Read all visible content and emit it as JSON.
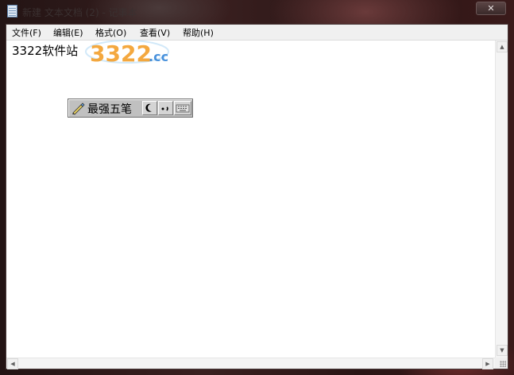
{
  "window": {
    "title": "新建 文本文档 (2) - 记事本",
    "close_label": "✕"
  },
  "menu": {
    "items": [
      {
        "label": "文件(F)"
      },
      {
        "label": "编辑(E)"
      },
      {
        "label": "格式(O)"
      },
      {
        "label": "查看(V)"
      },
      {
        "label": "帮助(H)"
      }
    ]
  },
  "editor": {
    "content": "3322软件站"
  },
  "watermark": {
    "text": "3322.cc",
    "colors": {
      "orange": "#f39a1e",
      "blue": "#2b7fd6"
    }
  },
  "ime": {
    "name": "最强五笔",
    "icons": [
      "pencil-brush-icon",
      "half-moon-icon",
      "punctuation-icon",
      "keyboard-icon"
    ]
  }
}
